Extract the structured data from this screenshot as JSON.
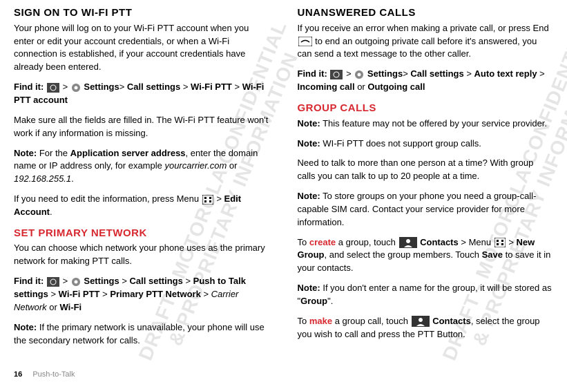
{
  "watermark": "DRAFT - MOTOROLA CONFIDENTIAL\n& PROPRIETARY INFORMATION",
  "col1": {
    "h1": "Sign on to Wi-Fi PTT",
    "p1a": "Your phone will log on to your Wi-Fi PTT account when you enter or edit your account credentials, or when a Wi-Fi connection is established, if your account credentials have already been entered.",
    "find1_label": "Find it:",
    "find1_settings": "Settings",
    "find1_callsettings": "Call settings",
    "find1_wifiptt": "Wi-Fi PTT",
    "find1_acct": "Wi-Fi PTT account",
    "p1b": "Make sure all the fields are filled in. The Wi-Fi PTT feature won't work if any information is missing.",
    "note1_label": "Note:",
    "note1_a": " For the ",
    "note1_b": "Application server address",
    "note1_c": ", enter the domain name or IP address only, for example ",
    "note1_d": "yourcarrier.com",
    "note1_e": " or ",
    "note1_f": "192.168.255.1",
    "note1_g": ".",
    "p1c_a": "If you need to edit the information, press Menu ",
    "p1c_b": " > ",
    "p1c_c": "Edit Account",
    "p1c_d": ".",
    "h2": "Set primary network",
    "p2a": "You can choose which network your phone uses as the primary network for making PTT calls.",
    "find2_label": "Find it:",
    "find2_settings": "Settings",
    "find2_callsettings": "Call settings",
    "find2_pushto": "Push to Talk settings",
    "find2_wifiptt": "Wi-Fi PTT",
    "find2_primary": "Primary PTT Network",
    "find2_carrier": "Carrier Network",
    "find2_or": " or ",
    "find2_wifi": "Wi-Fi",
    "note2_label": "Note:",
    "note2_txt": " If the primary network is unavailable, your phone will use the secondary network for calls."
  },
  "col2": {
    "h1": "Unanswered calls",
    "p1a_a": "If you receive an error when making a private call, or press End ",
    "p1a_b": " to end an outgoing private call before it's answered, you can send a text message to the other caller.",
    "find1_label": "Find it:",
    "find1_settings": "Settings",
    "find1_callsettings": "Call settings",
    "find1_auto": "Auto text reply",
    "find1_incoming": "Incoming call",
    "find1_or": " or ",
    "find1_outgoing": "Outgoing call",
    "h2": "Group calls",
    "note1_label": "Note:",
    "note1_txt": " This feature may not be offered by your service provider.",
    "note2_label": "Note:",
    "note2_txt": " WI-Fi PTT does not support group calls.",
    "p2a": "Need to talk to more than one person at a time? With group calls you can talk to up to 20 people at a time.",
    "note3_label": "Note:",
    "note3_txt": " To store groups on your phone you need a group-call-capable SIM card. Contact your service provider for more information.",
    "create_a": "To ",
    "create_word": "create",
    "create_b": " a group, touch ",
    "create_contacts": "Contacts",
    "create_c": " > Menu ",
    "create_d": " > ",
    "create_newgroup": "New Group",
    "create_e": ", and select the group members. Touch ",
    "create_save": "Save",
    "create_f": " to save it in your contacts.",
    "note4_label": "Note:",
    "note4_a": " If you don't enter a name for the group, it will be stored as \"",
    "note4_b": "Group",
    "note4_c": "\".",
    "make_a": "To ",
    "make_word": "make",
    "make_b": " a group call, touch ",
    "make_contacts": "Contacts",
    "make_c": ", select the group you wish to call and press the PTT Button."
  },
  "footer": {
    "page": "16",
    "section": "Push-to-Talk"
  }
}
